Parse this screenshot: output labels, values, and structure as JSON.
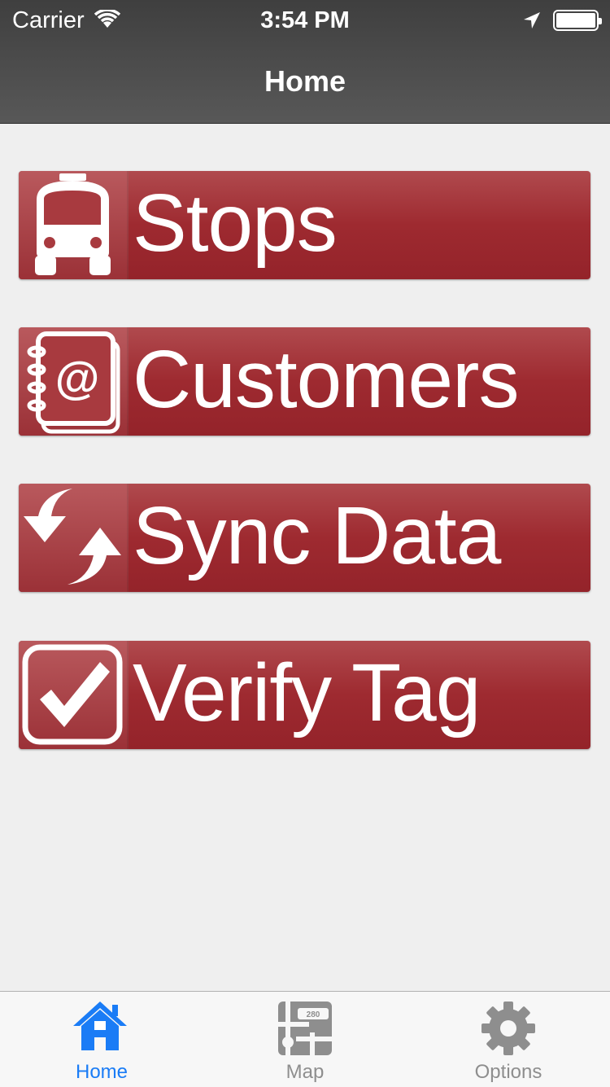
{
  "status_bar": {
    "carrier": "Carrier",
    "time": "3:54 PM"
  },
  "nav": {
    "title": "Home"
  },
  "menu": [
    {
      "label": "Stops",
      "icon": "bus-icon"
    },
    {
      "label": "Customers",
      "icon": "address-book-icon"
    },
    {
      "label": "Sync Data",
      "icon": "sync-arrows-icon"
    },
    {
      "label": "Verify Tag",
      "icon": "checkbox-icon"
    }
  ],
  "tabs": [
    {
      "label": "Home",
      "icon": "home-icon",
      "active": true
    },
    {
      "label": "Map",
      "icon": "map-icon",
      "active": false
    },
    {
      "label": "Options",
      "icon": "gear-icon",
      "active": false
    }
  ],
  "colors": {
    "button_red": "#9e2a30",
    "active_tab": "#1a7cf6",
    "inactive_tab": "#8e8e8e",
    "nav_bar": "#4a4a4a"
  }
}
